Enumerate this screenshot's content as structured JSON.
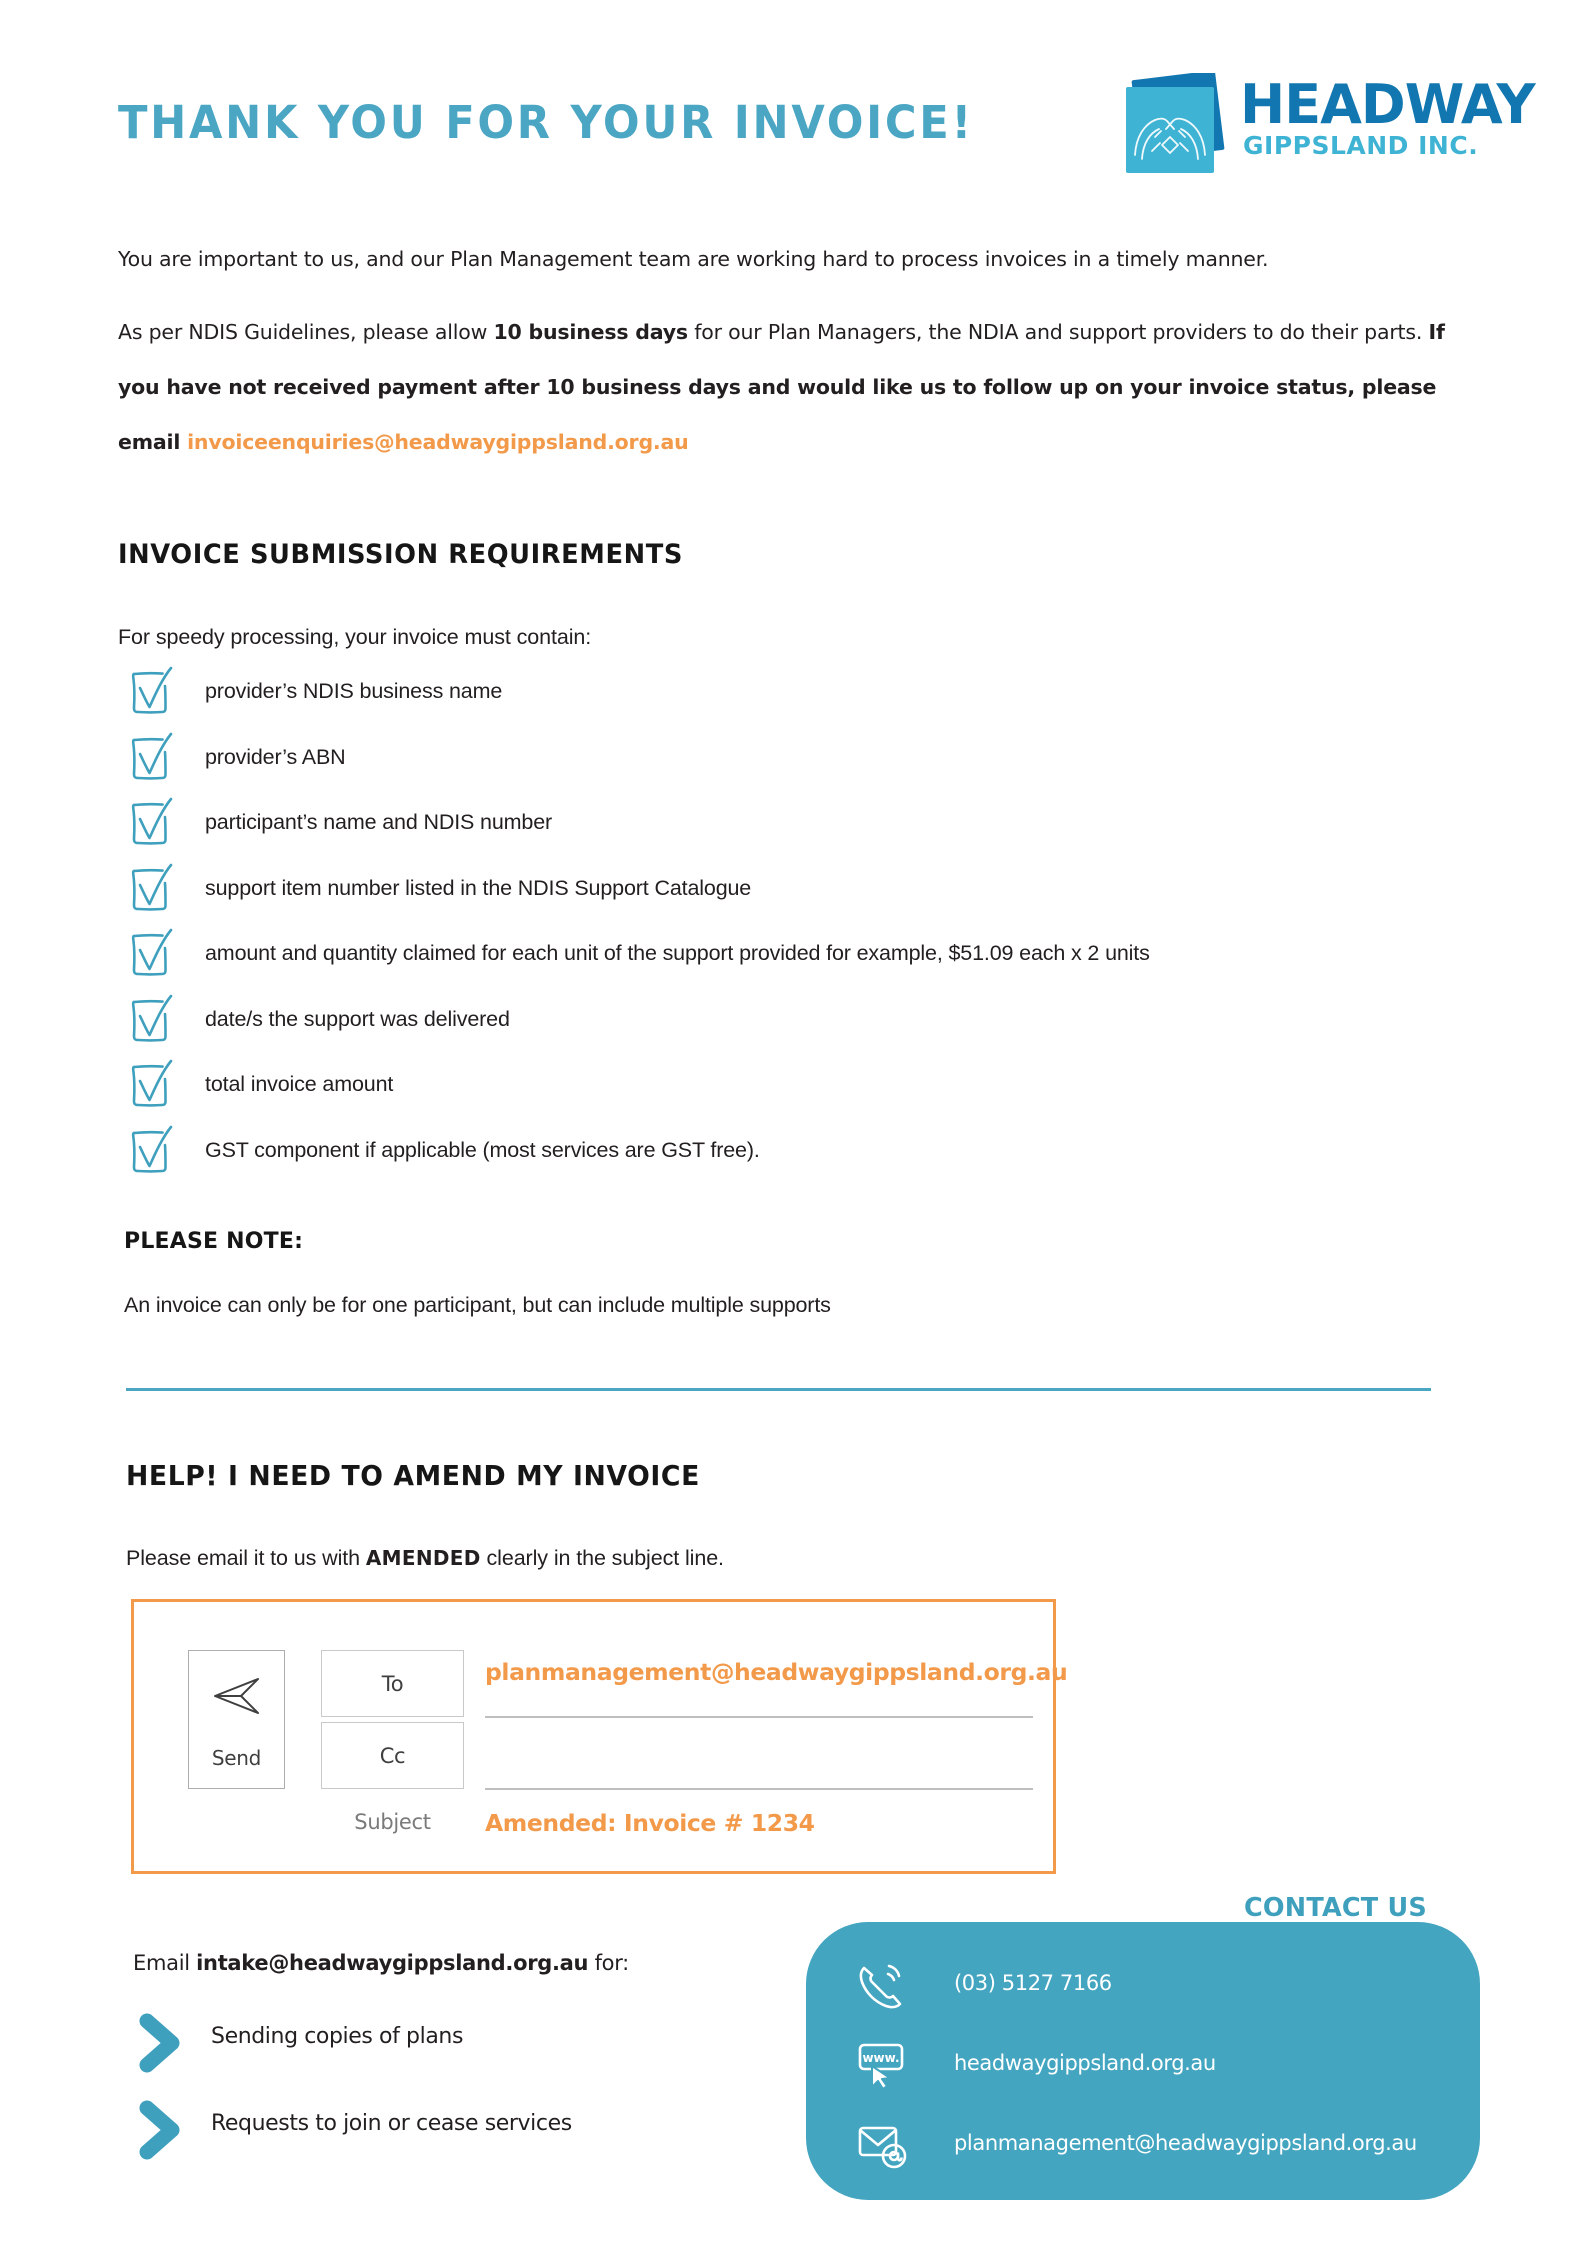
{
  "header": {
    "title": "THANK YOU FOR YOUR INVOICE!",
    "logo": {
      "name": "HEADWAY",
      "subtitle": "GIPPSLAND INC.",
      "mark_icon": "hands-holding-icon"
    }
  },
  "intro": {
    "paragraph_1": "You are important to us, and our Plan Management team are working hard to process invoices in a timely manner.",
    "p2_a": "As per NDIS Guidelines, please allow ",
    "p2_bold_1": "10 business days",
    "p2_b": " for our Plan Managers, the NDIA and support providers to do their parts. ",
    "p2_bold_2": "If you have not received payment after 10 business days and would like us to follow up on your invoice status, please email ",
    "p2_email": "invoiceenquiries@headwaygippsland.org.au"
  },
  "requirements": {
    "heading": "INVOICE SUBMISSION REQUIREMENTS",
    "lead": "For speedy processing, your invoice must contain:",
    "items": [
      "provider’s NDIS business name",
      "provider’s ABN",
      "participant’s name and NDIS number",
      "support item number listed in the NDIS Support Catalogue",
      "amount and quantity claimed for each unit of the support provided for example, $51.09 each x 2 units",
      "date/s the support was delivered",
      "total invoice amount",
      "GST component if applicable (most services are GST free)."
    ],
    "note_heading": "PLEASE NOTE:",
    "note_body": "An invoice can only be for one participant, but can include multiple supports"
  },
  "amend": {
    "heading": "HELP! I NEED TO AMEND MY INVOICE",
    "line_a": "Please email it to us with ",
    "line_bold": "AMENDED",
    "line_b": " clearly in the subject line.",
    "mail": {
      "send_label": "Send",
      "send_icon": "paper-plane-icon",
      "to_label": "To",
      "cc_label": "Cc",
      "subject_label": "Subject",
      "to_value": "planmanagement@headwaygippsland.org.au",
      "cc_value": "",
      "subject_value": "Amended: Invoice # 1234"
    }
  },
  "intake": {
    "line_a": "Email ",
    "line_bold": "intake@headwaygippsland.org.au",
    "line_b": " for:",
    "items": [
      "Sending copies of plans",
      "Requests to join or cease services"
    ]
  },
  "contact": {
    "heading": "CONTACT US",
    "rows": [
      {
        "icon": "phone-icon",
        "value": "(03) 5127 7166"
      },
      {
        "icon": "website-icon",
        "value": "headwaygippsland.org.au"
      },
      {
        "icon": "email-icon",
        "value": "planmanagement@headwaygippsland.org.au"
      }
    ]
  },
  "colors": {
    "teal": "#4BA6C4",
    "card_teal": "#43A5C0",
    "logo_blue": "#1277B0",
    "logo_cyan": "#3EB3D4",
    "orange": "#F2994A",
    "text": "#231f20"
  }
}
